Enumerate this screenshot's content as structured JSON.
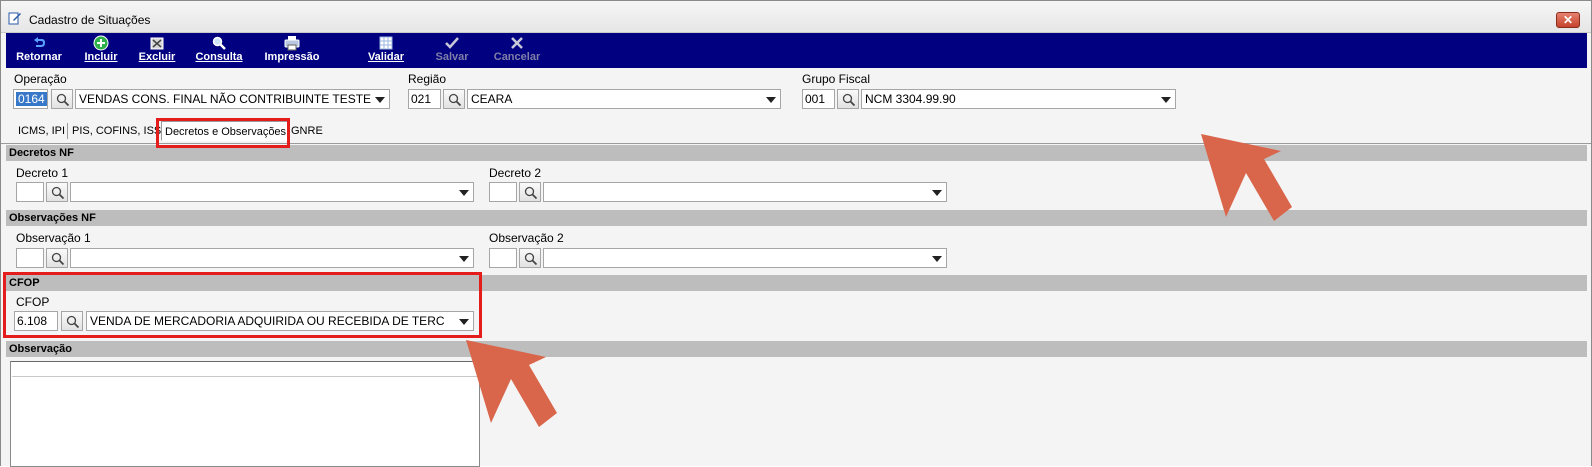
{
  "window": {
    "title": "Cadastro de Situações",
    "close_glyph": "✕"
  },
  "toolbar": {
    "items": [
      {
        "label": "Retornar",
        "icon": "return-arrow-icon"
      },
      {
        "label": "Incluir",
        "icon": "plus-circle-icon"
      },
      {
        "label": "Excluir",
        "icon": "delete-icon"
      },
      {
        "label": "Consulta",
        "icon": "magnifier-icon"
      },
      {
        "label": "Impressão",
        "icon": "printer-icon"
      },
      {
        "label": "Validar",
        "icon": "grid-check-icon"
      },
      {
        "label": "Salvar",
        "icon": "checkmark-icon",
        "disabled": true
      },
      {
        "label": "Cancelar",
        "icon": "x-icon",
        "disabled": true
      }
    ]
  },
  "header": {
    "operacao": {
      "label": "Operação",
      "code": "0164",
      "description": "VENDAS  CONS. FINAL NÃO CONTRIBUINTE TESTE"
    },
    "regiao": {
      "label": "Região",
      "code": "021",
      "description": "CEARA"
    },
    "grupo_fiscal": {
      "label": "Grupo Fiscal",
      "code": "001",
      "description": "NCM 3304.99.90"
    }
  },
  "tabs": [
    {
      "label": "ICMS, IPI",
      "active": false
    },
    {
      "label": "PIS, COFINS, ISS",
      "active": false
    },
    {
      "label": "Decretos e Observações",
      "active": true
    },
    {
      "label": "GNRE",
      "active": false
    }
  ],
  "sections": {
    "decretos": {
      "title": "Decretos NF",
      "decreto1": {
        "label": "Decreto 1",
        "code": "",
        "description": ""
      },
      "decreto2": {
        "label": "Decreto 2",
        "code": "",
        "description": ""
      }
    },
    "observacoes": {
      "title": "Observações NF",
      "obs1": {
        "label": "Observação 1",
        "code": "",
        "description": ""
      },
      "obs2": {
        "label": "Observação 2",
        "code": "",
        "description": ""
      }
    },
    "cfop": {
      "title": "CFOP",
      "label": "CFOP",
      "code": "6.108",
      "description": "VENDA DE MERCADORIA ADQUIRIDA OU RECEBIDA DE TERC"
    },
    "observacao": {
      "title": "Observação",
      "text": ""
    }
  },
  "colors": {
    "toolbar_bg": "#000080",
    "section_bar": "#bdbdbd",
    "highlight": "#e51c1c",
    "annotation_arrow": "#d9654a"
  }
}
